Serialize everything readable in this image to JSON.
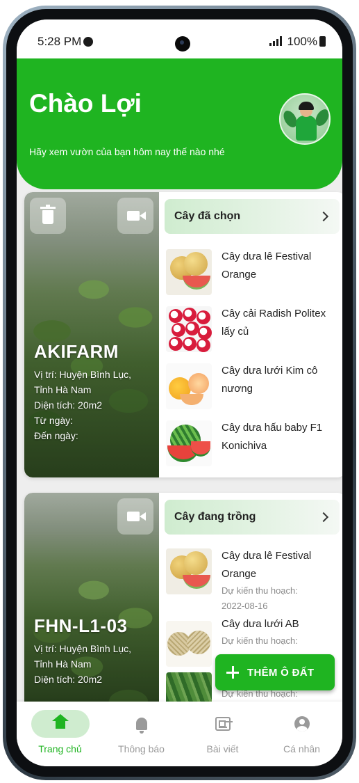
{
  "status_bar": {
    "time": "5:28 PM",
    "battery": "100%"
  },
  "header": {
    "greeting": "Chào Lợi",
    "subtitle": "Hãy xem vườn của bạn hôm nay thế nào nhé"
  },
  "farms": [
    {
      "name": "AKIFARM",
      "location_line1": "Vị trí: Huyện Bình Lục,",
      "location_line2": "Tỉnh Hà Nam",
      "area": "Diện tích: 20m2",
      "from": "Từ ngày:",
      "to": "Đến ngày:",
      "panel_title": "Cây đã chọn",
      "plants": [
        {
          "name": "Cây dưa lê Festival Orange",
          "icon": "festival-melon"
        },
        {
          "name": "Cây cải Radish Politex lấy củ",
          "icon": "radish"
        },
        {
          "name": "Cây dưa lưới Kim cô nương",
          "icon": "golden-melon"
        },
        {
          "name": "Cây dưa hấu baby F1 Konichiva",
          "icon": "watermelon"
        }
      ]
    },
    {
      "name": "FHN-L1-03",
      "location_line1": "Vị trí: Huyện Bình Lục,",
      "location_line2": "Tỉnh Hà Nam",
      "area": "Diện tích: 20m2",
      "panel_title": "Cây đang trồng",
      "plants": [
        {
          "name": "Cây dưa lê Festival Orange",
          "harvest_label": "Dự kiến thu hoạch:",
          "harvest_date": "2022-08-16",
          "icon": "festival-melon"
        },
        {
          "name": "Cây dưa lưới AB",
          "harvest_label": "Dự kiến thu hoạch:",
          "icon": "net-melon"
        },
        {
          "name": "",
          "harvest_label": "Dự kiến thu hoạch:",
          "icon": "leafy-greens"
        }
      ]
    }
  ],
  "fab": {
    "label": "THÊM Ô ĐẤT",
    "icon": "plus-icon"
  },
  "bottom_nav": [
    {
      "label": "Trang chủ",
      "icon": "home-icon",
      "active": true
    },
    {
      "label": "Thông báo",
      "icon": "bell-icon",
      "active": false
    },
    {
      "label": "Bài viết",
      "icon": "news-icon",
      "active": false
    },
    {
      "label": "Cá nhân",
      "icon": "account-icon",
      "active": false
    }
  ],
  "colors": {
    "primary": "#1fb421",
    "panel_tint": "#cfeccf",
    "background": "#eeeeee"
  }
}
